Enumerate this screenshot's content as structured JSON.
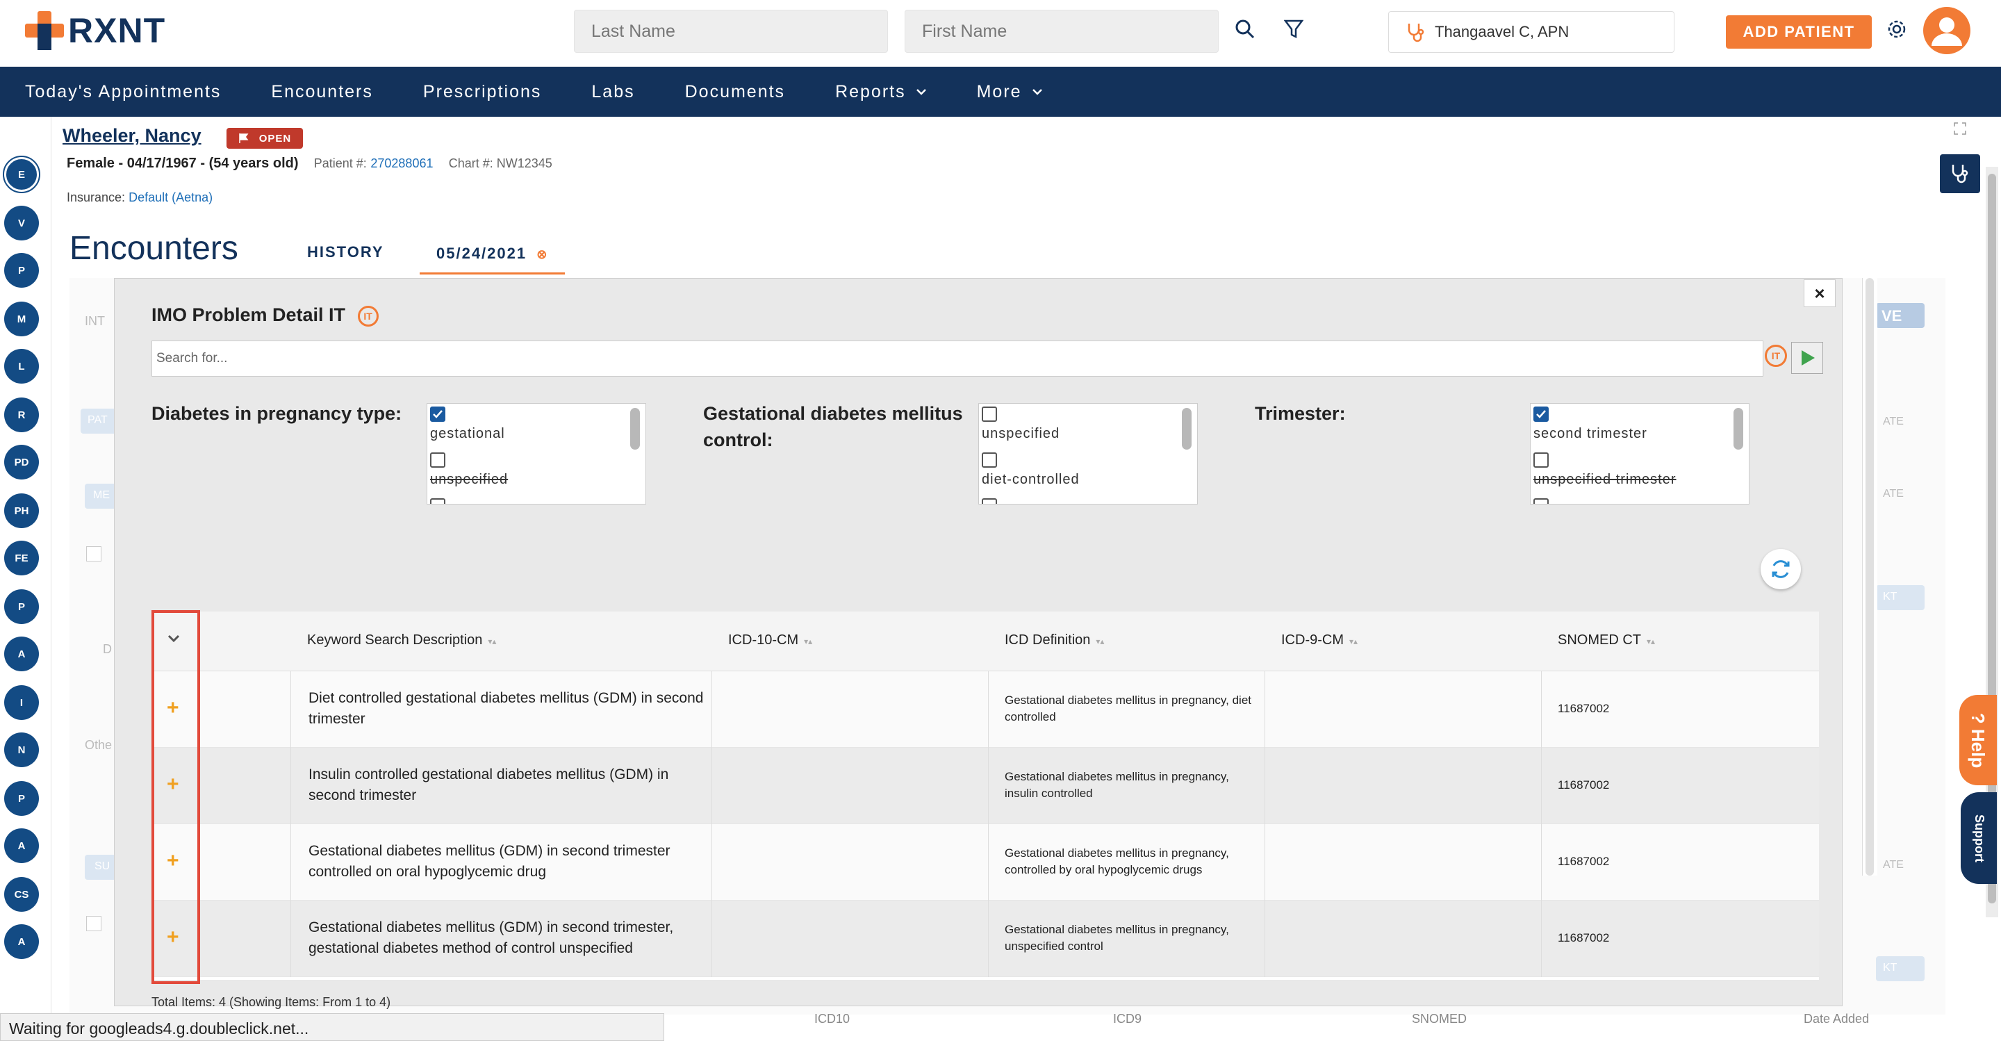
{
  "header": {
    "logo_text": "RXNT",
    "last_name_placeholder": "Last Name",
    "first_name_placeholder": "First Name",
    "provider": "Thangaavel C, APN",
    "add_patient": "ADD PATIENT"
  },
  "nav": {
    "items": [
      "Today's Appointments",
      "Encounters",
      "Prescriptions",
      "Labs",
      "Documents",
      "Reports",
      "More"
    ]
  },
  "sidebar": {
    "items": [
      "E",
      "V",
      "P",
      "M",
      "L",
      "R",
      "PD",
      "PH",
      "FE",
      "P",
      "A",
      "I",
      "N",
      "P",
      "A",
      "CS",
      "A"
    ]
  },
  "patient": {
    "name": "Wheeler, Nancy",
    "status": "OPEN",
    "demographics": "Female - 04/17/1967 - (54 years old)",
    "patient_label": "Patient #:",
    "patient_number": "270288061",
    "chart_label": "Chart #: NW12345",
    "insurance_label": "Insurance:",
    "insurance_value": "Default (Aetna)"
  },
  "encounters": {
    "title": "Encounters",
    "tab_history": "HISTORY",
    "tab_date": "05/24/2021"
  },
  "modal": {
    "title": "IMO Problem Detail IT",
    "search_placeholder": "Search for...",
    "close": "×",
    "filters": {
      "diabetes_label": "Diabetes in pregnancy type:",
      "diabetes_options": [
        "gestational",
        "unspecified"
      ],
      "control_label": "Gestational diabetes mellitus control:",
      "control_options": [
        "unspecified",
        "diet-controlled"
      ],
      "trimester_label": "Trimester:",
      "trimester_options": [
        "second trimester",
        "unspecified trimester"
      ]
    },
    "table": {
      "headers": [
        "Keyword Search Description",
        "ICD-10-CM",
        "ICD Definition",
        "ICD-9-CM",
        "SNOMED CT"
      ],
      "rows": [
        {
          "description": "Diet controlled gestational diabetes mellitus (GDM) in second trimester",
          "icd10": "",
          "definition": "Gestational diabetes mellitus in pregnancy, diet controlled",
          "icd9": "",
          "snomed": "11687002"
        },
        {
          "description": "Insulin controlled gestational diabetes mellitus (GDM) in second trimester",
          "icd10": "",
          "definition": "Gestational diabetes mellitus in pregnancy, insulin controlled",
          "icd9": "",
          "snomed": "11687002"
        },
        {
          "description": "Gestational diabetes mellitus (GDM) in second trimester controlled on oral hypoglycemic drug",
          "icd10": "",
          "definition": "Gestational diabetes mellitus in pregnancy, controlled by oral hypoglycemic drugs",
          "icd9": "",
          "snomed": "11687002"
        },
        {
          "description": "Gestational diabetes mellitus (GDM) in second trimester, gestational diabetes method of control unspecified",
          "icd10": "",
          "definition": "Gestational diabetes mellitus in pregnancy, unspecified control",
          "icd9": "",
          "snomed": "11687002"
        }
      ],
      "total": "Total Items: 4   (Showing Items: From 1 to 4)"
    }
  },
  "background": {
    "ghost_int": "INT",
    "ghost_pat": "PAT",
    "ghost_me": "ME",
    "ghost_d": "D",
    "ghost_other": "Othe",
    "ghost_su": "SU",
    "ghost_ve": "VE",
    "ghost_ate": "ATE",
    "ghost_kt": "KT",
    "footer_cols": [
      "ICD10",
      "ICD9",
      "SNOMED",
      "Date Added"
    ]
  },
  "status_bar": "Waiting for googleads4.g.doubleclick.net...",
  "help": "? Help",
  "support": "Support"
}
